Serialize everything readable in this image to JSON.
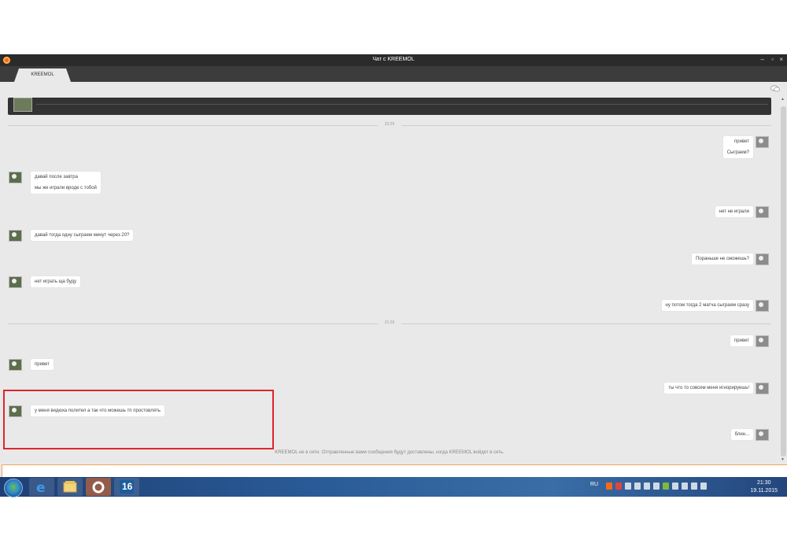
{
  "window": {
    "title": "Чат с KREEMOL",
    "tab_label": "KREEMOL",
    "accent_color": "#f26b1d",
    "controls": {
      "minimize": "–",
      "maximize": "▫",
      "close": "×"
    }
  },
  "separators": [
    "23:29",
    "21:26"
  ],
  "messages": [
    {
      "dir": "out",
      "lines": [
        "привет",
        "Сыграем?"
      ]
    },
    {
      "dir": "in",
      "lines": [
        "давай после завтра",
        "мы же играли вроде с тобой"
      ]
    },
    {
      "dir": "out",
      "lines": [
        "нет не играли"
      ]
    },
    {
      "dir": "in",
      "lines": [
        "давай тогда одну сыграем минут через 20?"
      ]
    },
    {
      "dir": "out",
      "lines": [
        "Пораньше не сможешь?"
      ]
    },
    {
      "dir": "in",
      "lines": [
        "нет играть ща буду"
      ]
    },
    {
      "dir": "out",
      "lines": [
        "ну потом тогда 2 матча сыграем сразу"
      ]
    },
    {
      "dir": "out",
      "lines": [
        "привет"
      ]
    },
    {
      "dir": "in",
      "lines": [
        "привет"
      ]
    },
    {
      "dir": "out",
      "lines": [
        "ты что то совсем меня игнорируешь!"
      ]
    },
    {
      "dir": "in",
      "lines": [
        "у меня видюха полител а так что можешь тп простовлять"
      ]
    },
    {
      "dir": "out",
      "lines": [
        "блин..."
      ]
    }
  ],
  "status": "KREEMOL не в сети. Отправленные вами сообщения будут доставлены, когда KREEMOL войдет в сеть.",
  "input": {
    "value": "",
    "placeholder": ""
  },
  "taskbar": {
    "pinned": [
      "internet-explorer",
      "file-explorer",
      "origin",
      "app-16"
    ],
    "app16_label": "16",
    "language": "RU",
    "time": "21:30",
    "date": "19.11.2015"
  }
}
